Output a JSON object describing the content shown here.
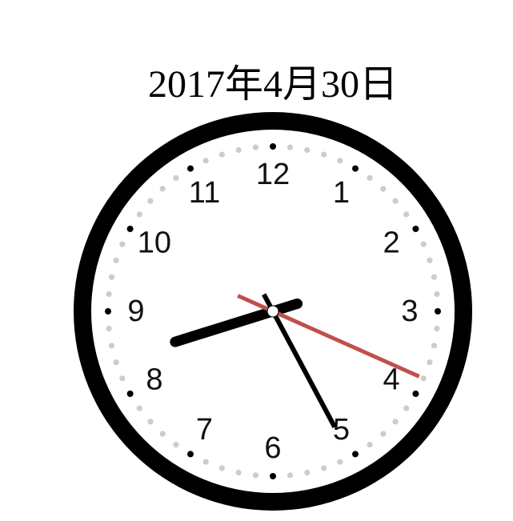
{
  "header": {
    "date_label": "2017年4月30日"
  },
  "clock": {
    "numerals": [
      "12",
      "1",
      "2",
      "3",
      "4",
      "5",
      "6",
      "7",
      "8",
      "9",
      "10",
      "11"
    ],
    "time": {
      "hours": 8,
      "minutes": 25,
      "seconds": 19
    },
    "colors": {
      "rim": "#000000",
      "face": "#ffffff",
      "hour_dot": "#000000",
      "minute_dot": "#cccccc",
      "hour_hand": "#000000",
      "minute_hand": "#000000",
      "second_hand": "#c0504d",
      "center_cap": "#ffffff"
    }
  }
}
